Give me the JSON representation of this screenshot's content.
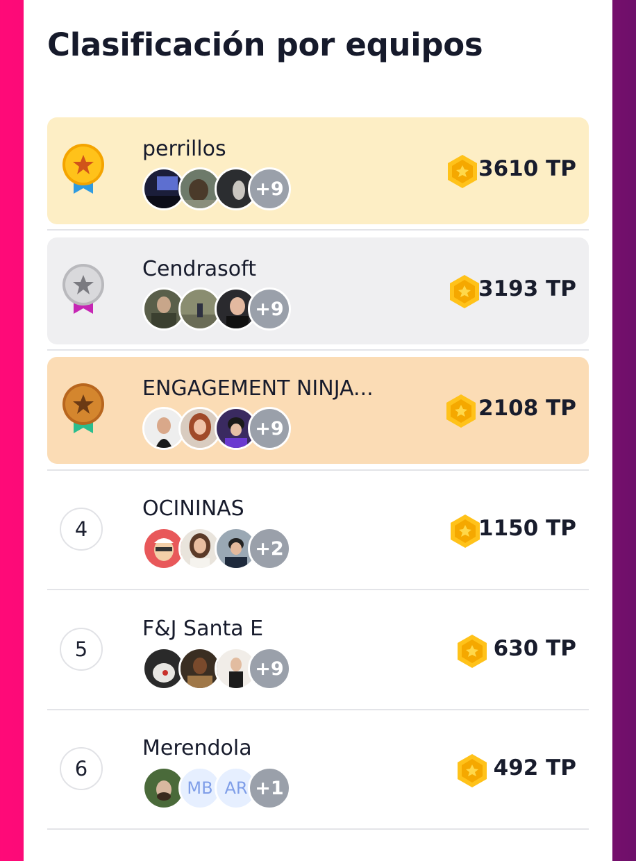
{
  "title": "Clasificación por equipos",
  "colors": {
    "gold_row": "#fdeec5",
    "silver_row": "#efeff1",
    "bronze_row": "#fbdcb5",
    "coin": "#ffc21a"
  },
  "teams": [
    {
      "rank": "1",
      "medal": "gold-medal-icon",
      "name": "perrillos",
      "extra": "+9",
      "points": "3610 TP"
    },
    {
      "rank": "2",
      "medal": "silver-medal-icon",
      "name": "Cendrasoft",
      "extra": "+9",
      "points": "3193 TP"
    },
    {
      "rank": "3",
      "medal": "bronze-medal-icon",
      "name": "ENGAGEMENT NINJA...",
      "extra": "+9",
      "points": "2108 TP"
    },
    {
      "rank": "4",
      "name": "OCININAS",
      "extra": "+2",
      "points": "1150 TP"
    },
    {
      "rank": "5",
      "name": "F&J Santa E",
      "extra": "+9",
      "points": "630 TP"
    },
    {
      "rank": "6",
      "name": "Merendola",
      "initials": [
        "MB",
        "AR"
      ],
      "extra": "+1",
      "points": "492 TP"
    }
  ]
}
